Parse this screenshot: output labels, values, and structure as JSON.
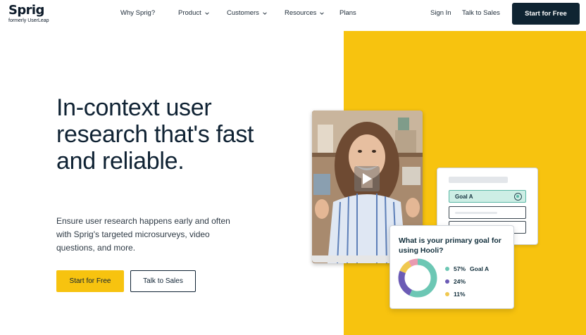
{
  "brand": {
    "name": "Sprig",
    "subtitle": "formerly UserLeap"
  },
  "nav": {
    "items": [
      {
        "label": "Why Sprig?",
        "dropdown": false
      },
      {
        "label": "Product",
        "dropdown": true
      },
      {
        "label": "Customers",
        "dropdown": true
      },
      {
        "label": "Resources",
        "dropdown": true
      },
      {
        "label": "Plans",
        "dropdown": false
      }
    ],
    "sign_in": "Sign In",
    "talk_to_sales": "Talk to Sales",
    "cta": "Start for Free"
  },
  "hero": {
    "headline": "In-context user research that's fast and reliable.",
    "subtext": "Ensure user research happens early and often with Sprig's targeted microsurveys, video questions, and more.",
    "primary_button": "Start for Free",
    "secondary_button": "Talk to Sales"
  },
  "form_card": {
    "selected_option": "Goal A"
  },
  "poll_card": {
    "question": "What is your primary goal for using Hooli?",
    "results": [
      {
        "value": "57%",
        "label": "Goal A",
        "color": "#6cc7b4",
        "fraction": 0.57
      },
      {
        "value": "24%",
        "label": "",
        "color": "#6b5bb5",
        "fraction": 0.24
      },
      {
        "value": "11%",
        "label": "",
        "color": "#f0c850",
        "fraction": 0.11
      }
    ],
    "remainder_color": "#e99ab0"
  },
  "colors": {
    "accent": "#f7c30f",
    "dark": "#0f2432"
  }
}
